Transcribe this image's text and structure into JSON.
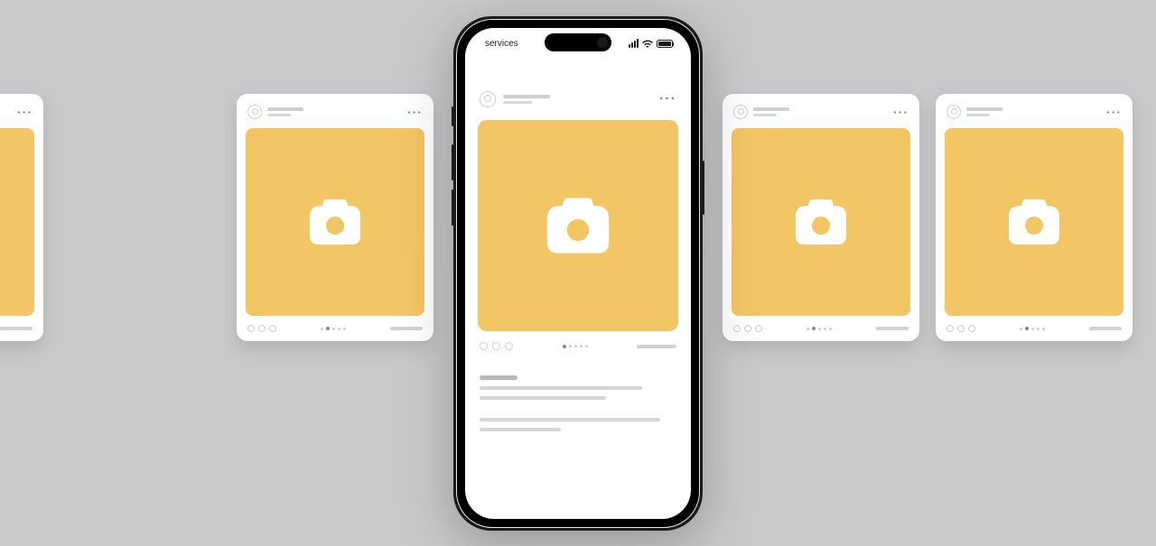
{
  "status_bar": {
    "carrier": "services"
  },
  "colors": {
    "image_bg": "#f2c565",
    "page_bg": "#c9c9cb"
  },
  "phone_post": {
    "pagination": {
      "count": 5,
      "active_index": 0
    }
  },
  "side_card": {
    "pagination": {
      "count": 5,
      "active_index": 1
    }
  }
}
